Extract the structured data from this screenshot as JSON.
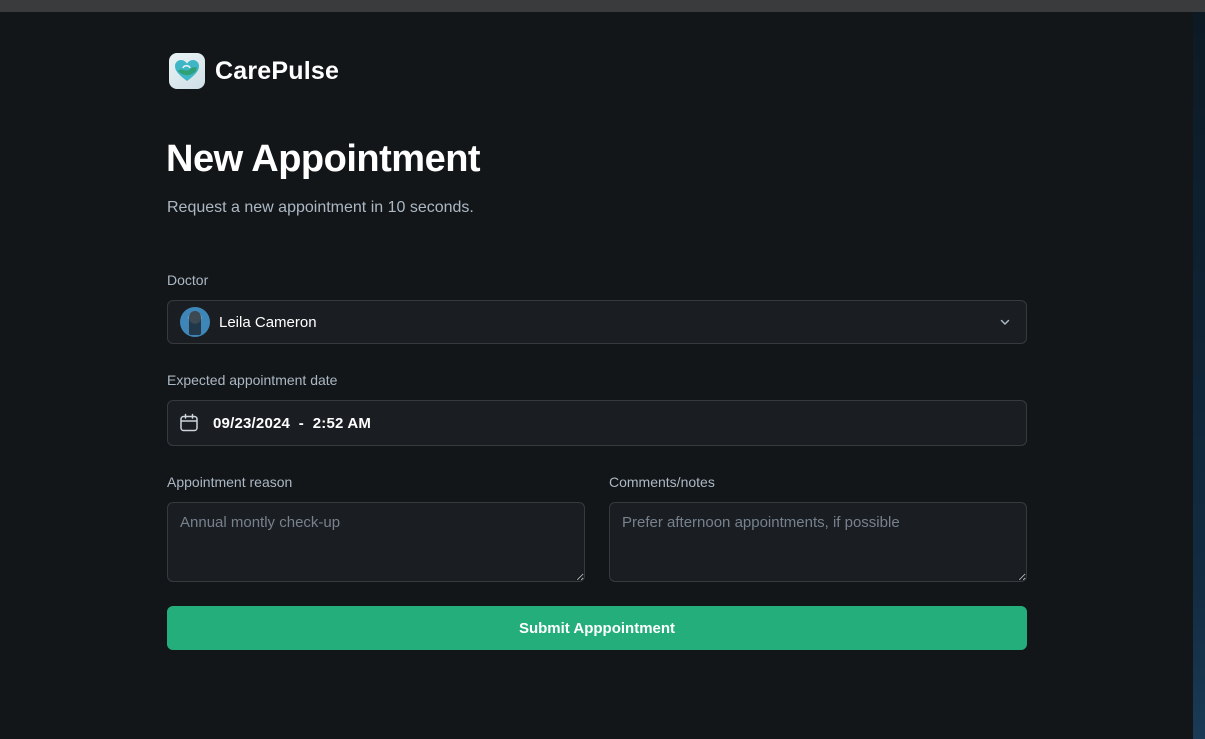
{
  "brand": {
    "name": "CarePulse"
  },
  "header": {
    "title": "New Appointment",
    "subtitle": "Request a new appointment in 10 seconds."
  },
  "form": {
    "doctor": {
      "label": "Doctor",
      "value": "Leila Cameron"
    },
    "date": {
      "label": "Expected appointment date",
      "value": "09/23/2024  -  2:52 AM"
    },
    "reason": {
      "label": "Appointment reason",
      "placeholder": "Annual montly check-up"
    },
    "notes": {
      "label": "Comments/notes",
      "placeholder": "Prefer afternoon appointments, if possible"
    },
    "submit_label": "Submit Apppointment"
  },
  "colors": {
    "background": "#131619",
    "field": "#1a1d21",
    "border": "#363a3d",
    "accent": "#24ae7c",
    "muted_text": "#abb8c4"
  }
}
